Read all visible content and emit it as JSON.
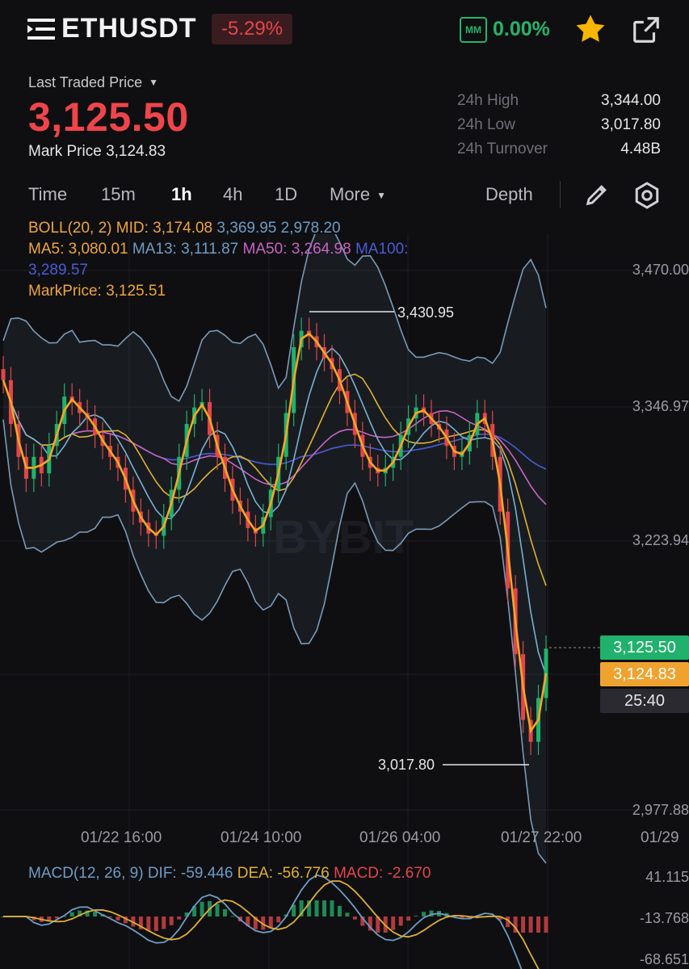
{
  "header": {
    "symbol": "ETHUSDT",
    "change_pct": "-5.29%",
    "mm_label": "MM",
    "mm_value": "0.00%",
    "icons": [
      "menu-icon",
      "star-icon",
      "share-icon"
    ]
  },
  "price": {
    "label": "Last Traded Price",
    "value": "3,125.50",
    "mark_label": "Mark Price",
    "mark_value": "3,124.83"
  },
  "stats": [
    {
      "label": "24h High",
      "value": "3,344.00"
    },
    {
      "label": "24h Low",
      "value": "3,017.80"
    },
    {
      "label": "24h Turnover",
      "value": "4.48B"
    }
  ],
  "tabs": {
    "time": "Time",
    "m15": "15m",
    "h1": "1h",
    "h4": "4h",
    "d1": "1D",
    "more": "More",
    "depth": "Depth",
    "active": "1h"
  },
  "indicators": {
    "boll_label": "BOLL(20, 2)",
    "boll_mid": "MID: 3,174.08",
    "boll_up": "3,369.95",
    "boll_dn": "2,978.20",
    "ma5": "MA5: 3,080.01",
    "ma13": "MA13: 3,111.87",
    "ma50": "MA50: 3,264.98",
    "ma100": "MA100:",
    "ma100_val": "3,289.57",
    "markprice": "MarkPrice: 3,125.51"
  },
  "chart_data": {
    "type": "candlestick",
    "symbol": "ETHUSDT",
    "interval": "1h",
    "y_ticks": [
      "3,470.00",
      "3,346.97",
      "3,223.94",
      "2,977.88"
    ],
    "x_ticks": [
      "01/22 16:00",
      "01/24 10:00",
      "01/26 04:00",
      "01/27 22:00",
      "01/29"
    ],
    "ylim": [
      2977.88,
      3470.0
    ],
    "annotations": {
      "high": "3,430.95",
      "low": "3,017.80"
    },
    "price_tags": {
      "last": "3,125.50",
      "mark": "3,124.83",
      "countdown": "25:40"
    },
    "close_series": [
      3370,
      3330,
      3300,
      3280,
      3300,
      3285,
      3310,
      3330,
      3355,
      3350,
      3340,
      3335,
      3320,
      3310,
      3300,
      3290,
      3270,
      3250,
      3240,
      3230,
      3228,
      3245,
      3270,
      3300,
      3330,
      3345,
      3350,
      3320,
      3300,
      3280,
      3260,
      3250,
      3235,
      3230,
      3245,
      3270,
      3300,
      3340,
      3400,
      3415,
      3410,
      3400,
      3390,
      3380,
      3360,
      3340,
      3320,
      3300,
      3290,
      3285,
      3290,
      3300,
      3320,
      3335,
      3345,
      3340,
      3330,
      3325,
      3310,
      3300,
      3305,
      3320,
      3340,
      3330,
      3300,
      3250,
      3180,
      3120,
      3060,
      3040,
      3080,
      3125
    ],
    "macd": {
      "title": "MACD(12, 26, 9)",
      "dif": "DIF: -59.446",
      "dea": "DEA: -56.776",
      "macd": "MACD: -2.670",
      "y_ticks": [
        "41.115",
        "-13.768",
        "-68.651"
      ]
    },
    "watermark": "BYBIT"
  }
}
